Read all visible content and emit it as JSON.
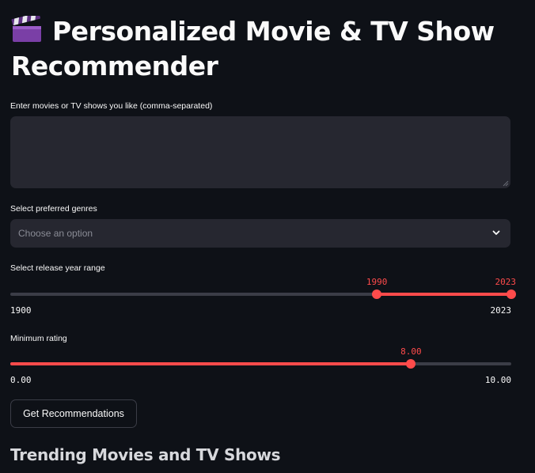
{
  "header": {
    "icon": "clapper-board-icon",
    "title_line1": "Personalized Movie & TV Show",
    "title_line2": "Recommender"
  },
  "movies_input": {
    "label": "Enter movies or TV shows you like (comma-separated)",
    "value": "",
    "placeholder": ""
  },
  "genres_select": {
    "label": "Select preferred genres",
    "placeholder": "Choose an option",
    "icon": "chevron-down-icon"
  },
  "year_range": {
    "label": "Select release year range",
    "min": 1900,
    "max": 2023,
    "low_value": 1990,
    "high_value": 2023,
    "min_label": "1900",
    "max_label": "2023",
    "low_label": "1990",
    "high_label": "2023"
  },
  "rating": {
    "label": "Minimum rating",
    "min": 0,
    "max": 10,
    "value": 8,
    "min_label": "0.00",
    "max_label": "10.00",
    "value_label": "8.00"
  },
  "actions": {
    "recommend_label": "Get Recommendations"
  },
  "trending": {
    "heading": "Trending Movies and TV Shows"
  },
  "colors": {
    "background": "#0e1117",
    "input_background": "#262730",
    "accent": "#ff4b4b",
    "text": "#fafafa",
    "muted_text": "#8a8c96"
  }
}
